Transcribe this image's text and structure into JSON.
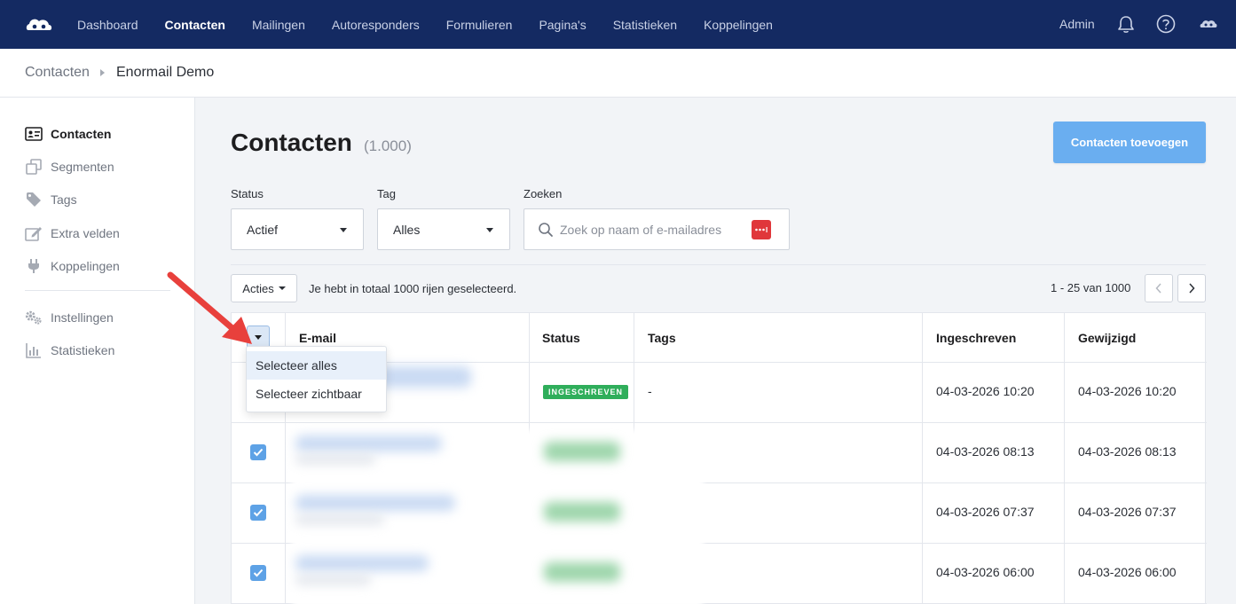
{
  "nav": {
    "items": [
      "Dashboard",
      "Contacten",
      "Mailingen",
      "Autoresponders",
      "Formulieren",
      "Pagina's",
      "Statistieken",
      "Koppelingen"
    ],
    "active": "Contacten",
    "admin_label": "Admin",
    "icons": [
      "logo-icon",
      "bell-icon",
      "help-icon",
      "account-icon"
    ]
  },
  "breadcrumb": {
    "parent": "Contacten",
    "current": "Enormail Demo"
  },
  "sidebar": {
    "items": [
      {
        "label": "Contacten",
        "icon": "contact-card-icon",
        "active": true
      },
      {
        "label": "Segmenten",
        "icon": "segments-icon"
      },
      {
        "label": "Tags",
        "icon": "tag-icon"
      },
      {
        "label": "Extra velden",
        "icon": "edit-field-icon"
      },
      {
        "label": "Koppelingen",
        "icon": "plug-icon"
      },
      {
        "label": "Instellingen",
        "icon": "gears-icon"
      },
      {
        "label": "Statistieken",
        "icon": "bar-chart-icon"
      }
    ]
  },
  "page": {
    "title": "Contacten",
    "count": "(1.000)",
    "add_button": "Contacten toevoegen"
  },
  "filters": {
    "status": {
      "label": "Status",
      "value": "Actief"
    },
    "tag": {
      "label": "Tag",
      "value": "Alles"
    },
    "search": {
      "label": "Zoeken",
      "placeholder": "Zoek op naam of e-mailadres"
    }
  },
  "toolbar": {
    "actions_label": "Acties",
    "selection_text": "Je hebt in totaal 1000 rijen geselecteerd.",
    "pager_text": "1 - 25 van 1000"
  },
  "table": {
    "headers": [
      "E-mail",
      "Status",
      "Tags",
      "Ingeschreven",
      "Gewijzigd"
    ],
    "rows": [
      {
        "status": "INGESCHREVEN",
        "tags": "-",
        "subscribed": "04-03-2026 10:20",
        "modified": "04-03-2026 10:20",
        "checked": true
      },
      {
        "subscribed": "04-03-2026 08:13",
        "modified": "04-03-2026 08:13",
        "checked": true
      },
      {
        "subscribed": "04-03-2026 07:37",
        "modified": "04-03-2026 07:37",
        "checked": true
      },
      {
        "subscribed": "04-03-2026 06:00",
        "modified": "04-03-2026 06:00",
        "checked": true
      }
    ]
  },
  "dropdown": {
    "items": [
      "Selecteer alles",
      "Selecteer zichtbaar"
    ],
    "highlighted": "Selecteer alles"
  },
  "colors": {
    "nav_bg": "#142a62",
    "accent": "#6aaef0",
    "status_green": "#2fae5b",
    "annotation_arrow": "#e8403c"
  }
}
